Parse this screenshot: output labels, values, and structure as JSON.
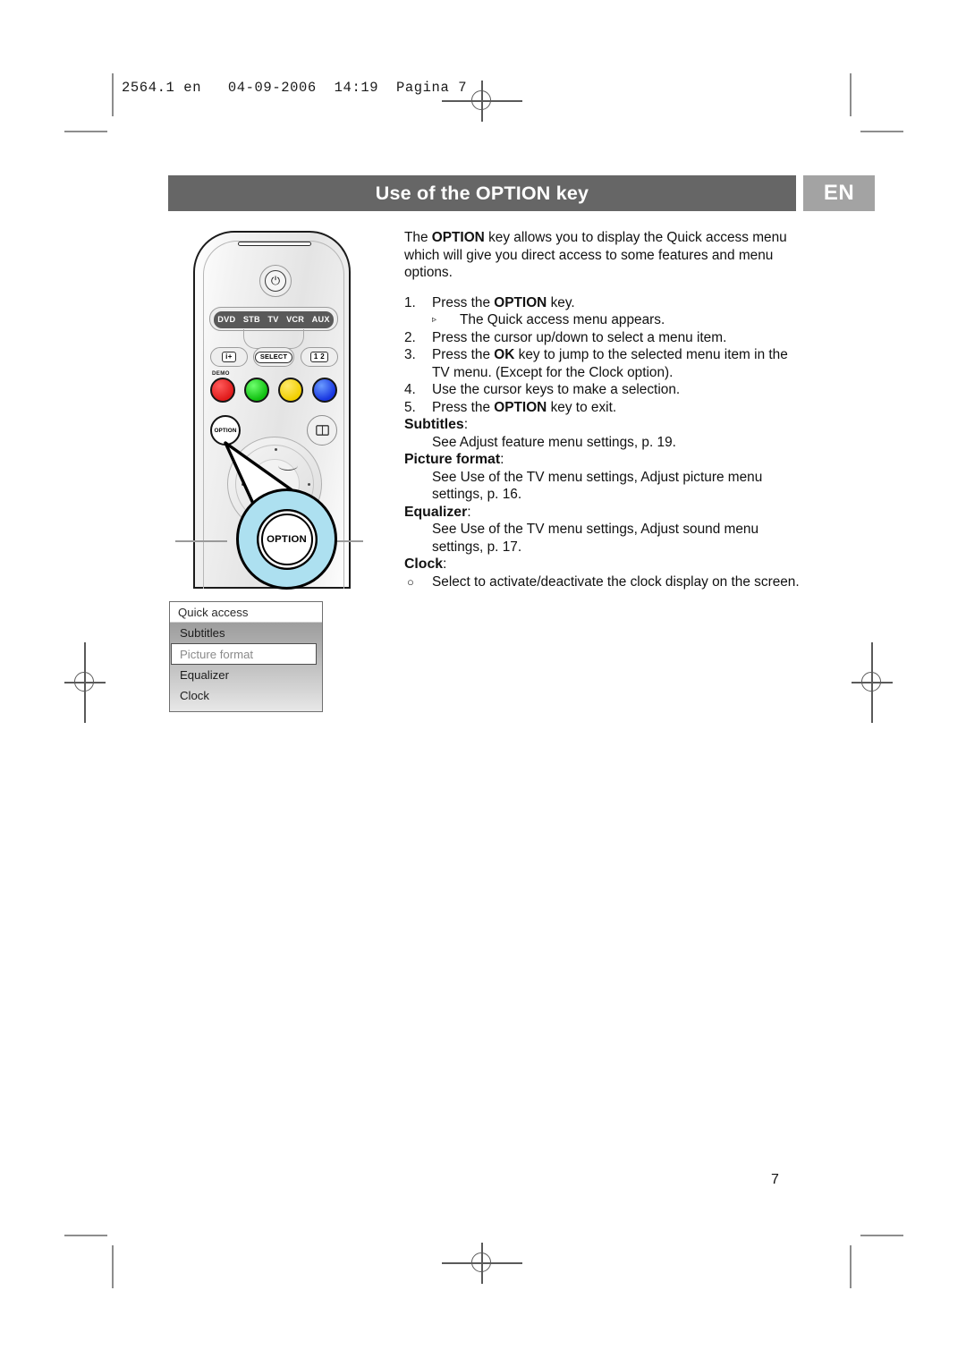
{
  "printer": {
    "slug": "2564.1 en   04-09-2006  14:19  Pagina 7"
  },
  "header": {
    "title_prefix": "Use of the ",
    "title_bold": "OPTION",
    "title_suffix": " key",
    "title_full": "Use of the OPTION key",
    "language_badge": "EN",
    "band_color": "#666666",
    "badge_color": "#a3a3a3"
  },
  "body": {
    "intro": {
      "part1": "The ",
      "bold1": "OPTION",
      "part2": " key allows you to display the Quick access menu which will give you direct access to some features and menu options."
    },
    "steps": [
      {
        "num": "1.",
        "part1": "Press the ",
        "bold1": "OPTION",
        "part2": " key.",
        "substep": {
          "marker": "▹",
          "text": "The Quick access menu appears."
        }
      },
      {
        "num": "2.",
        "part1": "Press the cursor up/down to select a menu item.",
        "bold1": "",
        "part2": ""
      },
      {
        "num": "3.",
        "part1": "Press the ",
        "bold1": "OK",
        "part2": " key to jump to the selected menu item in the TV menu. (Except for the Clock option)."
      },
      {
        "num": "4.",
        "part1": "Use the cursor keys to make a selection.",
        "bold1": "",
        "part2": ""
      },
      {
        "num": "5.",
        "part1": "Press the ",
        "bold1": "OPTION",
        "part2": " key to exit."
      }
    ],
    "sections": [
      {
        "heading": "Subtitles",
        "colon": ":",
        "text": "See Adjust feature menu settings, p. 19."
      },
      {
        "heading": "Picture format",
        "colon": ":",
        "text": "See Use of the TV menu settings, Adjust picture menu settings, p. 16."
      },
      {
        "heading": "Equalizer",
        "colon": ":",
        "text": "See Use of the TV menu settings, Adjust sound menu settings, p. 17."
      },
      {
        "heading": "Clock",
        "colon": ":",
        "bullet_marker": "○",
        "text": "Select to activate/deactivate the clock display on the screen."
      }
    ]
  },
  "remote": {
    "power_icon": "⏻",
    "mode_buttons": [
      "DVD",
      "STB",
      "TV",
      "VCR",
      "AUX"
    ],
    "info_key": "i+",
    "select_key": "SELECT",
    "pip_key": "1 2",
    "demo_label": "DEMO",
    "color_keys": [
      {
        "name": "red",
        "color": "#e01b1b"
      },
      {
        "name": "green",
        "color": "#10c010"
      },
      {
        "name": "yellow",
        "color": "#f2cf00"
      },
      {
        "name": "blue",
        "color": "#1836e0"
      }
    ],
    "option_key": "OPTION",
    "book_icon": "📖"
  },
  "callout": {
    "key_label": "OPTION",
    "disc_color": "#ade0f0"
  },
  "osd": {
    "title": "Quick access",
    "items": [
      {
        "label": "Subtitles",
        "selected": false
      },
      {
        "label": "Picture format",
        "selected": true
      },
      {
        "label": "Equalizer",
        "selected": false
      },
      {
        "label": "Clock",
        "selected": false
      }
    ]
  },
  "footer": {
    "page_number": "7"
  }
}
